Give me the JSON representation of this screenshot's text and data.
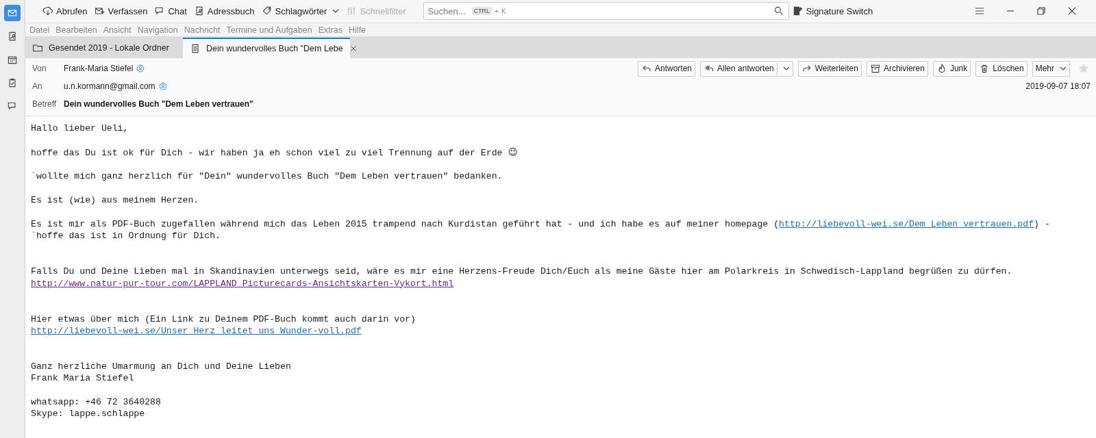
{
  "spaces": [
    {
      "kind": "mail",
      "selected": true
    },
    {
      "kind": "contacts",
      "selected": false
    },
    {
      "kind": "calendar",
      "selected": false
    },
    {
      "kind": "tasks",
      "selected": false
    },
    {
      "kind": "chat",
      "selected": false
    }
  ],
  "toolbar": [
    {
      "kind": "download",
      "label": "Abrufen",
      "disabled": false
    },
    {
      "kind": "compose",
      "label": "Verfassen",
      "disabled": false
    },
    {
      "kind": "chat",
      "label": "Chat",
      "disabled": false
    },
    {
      "kind": "addressbook",
      "label": "Adressbuch",
      "disabled": false
    },
    {
      "kind": "tag",
      "label": "Schlagwörter",
      "disabled": false,
      "dropdown": true
    },
    {
      "kind": "filter",
      "label": "Schnellfilter",
      "disabled": true
    }
  ],
  "search": {
    "placeholder": "Suchen...",
    "keys": [
      "CTRL",
      "+",
      "K"
    ]
  },
  "signature_switch": "Signature Switch",
  "menu": [
    "Datei",
    "Bearbeiten",
    "Ansicht",
    "Navigation",
    "Nachricht",
    "Termine und Aufgaben",
    "Extras",
    "Hilfe"
  ],
  "tabs": [
    {
      "kind": "folder",
      "label": "Gesendet 2019 - Lokale Ordner",
      "selected": false
    },
    {
      "kind": "message",
      "label": "Dein wundervolles Buch \"Dem Lebe",
      "selected": true
    }
  ],
  "header": {
    "from_label": "Von",
    "from": "Frank-Maria Stiefel",
    "to_label": "An",
    "to": "u.n.kormann@gmail.com",
    "subject_label": "Betreff",
    "subject": "Dein wundervolles Buch \"Dem Leben vertrauen\"",
    "date": "2019-09-07 18:07",
    "actions": [
      {
        "kind": "reply",
        "label": "Antworten"
      },
      {
        "kind": "replyall",
        "label": "Allen antworten"
      },
      {
        "kind": "forward",
        "label": "Weiterleiten"
      },
      {
        "kind": "archive",
        "label": "Archivieren"
      },
      {
        "kind": "junk",
        "label": "Junk"
      },
      {
        "kind": "delete",
        "label": "Löschen"
      },
      {
        "kind": "more",
        "label": "Mehr"
      }
    ],
    "starred": false
  },
  "body": [
    {
      "kind": "normal",
      "lines": [
        [
          {
            "kind": "text",
            "text": "Hallo lieber Ueli,"
          }
        ]
      ]
    },
    {
      "kind": "normal",
      "lines": [
        [
          {
            "kind": "text",
            "text": "hoffe das Du ist ok für Dich - wir haben ja eh schon viel zu viel Trennung auf der Erde "
          },
          {
            "kind": "emoji",
            "text": "😉"
          }
        ]
      ]
    },
    {
      "kind": "normal",
      "lines": [
        [
          {
            "kind": "text",
            "text": "`wollte mich ganz herzlich für \"Dein\" wundervolles Buch \"Dem Leben vertrauen\" bedanken."
          }
        ]
      ]
    },
    {
      "kind": "normal",
      "lines": [
        [
          {
            "kind": "text",
            "text": "Es ist (wie) aus meinem Herzen."
          }
        ]
      ]
    },
    {
      "kind": "normal",
      "lines": [
        [
          {
            "kind": "text",
            "text": "Es ist mir als PDF-Buch zugefallen während mich das Leben 2015 trampend nach Kurdistan geführt hat - und ich habe es auf meiner homepage ("
          },
          {
            "kind": "link",
            "text": "http://liebevoll-wei.se/Dem_Leben_vertrauen.pdf",
            "visited": false
          },
          {
            "kind": "text",
            "text": ") -"
          }
        ],
        [
          {
            "kind": "text",
            "text": "`hoffe das ist in Ordnung für Dich."
          }
        ]
      ]
    },
    {
      "kind": "spaced",
      "lines": [
        [
          {
            "kind": "text",
            "text": "Falls Du und Deine Lieben mal in Skandinavien unterwegs seid, wäre es mir eine Herzens-Freude Dich/Euch als meine Gäste hier am Polarkreis in Schwedisch-Lappland begrüßen zu dürfen."
          }
        ],
        [
          {
            "kind": "link",
            "text": "http://www.natur-pur-tour.com/LAPPLAND_Picturecards-Ansichtskarten-Vykort.html",
            "visited": true
          }
        ]
      ]
    },
    {
      "kind": "spaced",
      "lines": [
        [
          {
            "kind": "text",
            "text": "Hier etwas über mich (Ein Link zu Deinem PDF-Buch kommt auch darin vor)"
          }
        ],
        [
          {
            "kind": "link",
            "text": "http://liebevoll-wei.se/Unser_Herz_leitet_uns_Wunder-voll.pdf",
            "visited": false
          }
        ]
      ]
    },
    {
      "kind": "spaced",
      "lines": [
        [
          {
            "kind": "text",
            "text": "Ganz herzliche Umarmung an Dich und Deine Lieben"
          }
        ],
        [
          {
            "kind": "text",
            "text": "Frank Maria Stiefel"
          }
        ]
      ]
    },
    {
      "kind": "normal",
      "lines": [
        [
          {
            "kind": "text",
            "text": "whatsapp: +46 72 3640288"
          }
        ],
        [
          {
            "kind": "text",
            "text": "Skype: lappe.schlappe"
          }
        ]
      ]
    }
  ]
}
